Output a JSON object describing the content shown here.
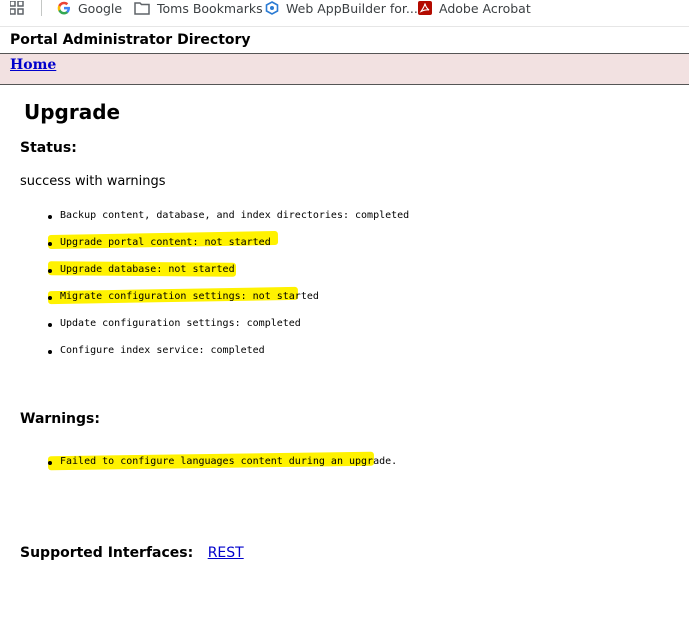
{
  "bookmarks": {
    "items": [
      {
        "label": "Google",
        "icon": "google-icon"
      },
      {
        "label": "Toms Bookmarks",
        "icon": "folder-icon"
      },
      {
        "label": "Web AppBuilder for...",
        "icon": "appbuilder-icon"
      },
      {
        "label": "Adobe Acrobat",
        "icon": "acrobat-icon"
      }
    ],
    "apps_icon": "apps-grid-icon"
  },
  "header": {
    "title": "Portal Administrator Directory"
  },
  "nav": {
    "home_label": "Home"
  },
  "page": {
    "title": "Upgrade"
  },
  "status": {
    "heading": "Status:",
    "value": "success with warnings",
    "steps": [
      "Backup content, database, and index directories: completed",
      "Upgrade portal content: not started",
      "Upgrade database: not started",
      "Migrate configuration settings: not started",
      "Update configuration settings: completed",
      "Configure index service: completed"
    ]
  },
  "warnings": {
    "heading": "Warnings:",
    "items": [
      "Failed to configure languages content during an upgrade."
    ]
  },
  "interfaces": {
    "label": "Supported Interfaces:",
    "links": [
      "REST"
    ]
  },
  "colors": {
    "highlight": "#fff200",
    "link": "#0000cc",
    "nav_background": "#f2e1e1"
  }
}
